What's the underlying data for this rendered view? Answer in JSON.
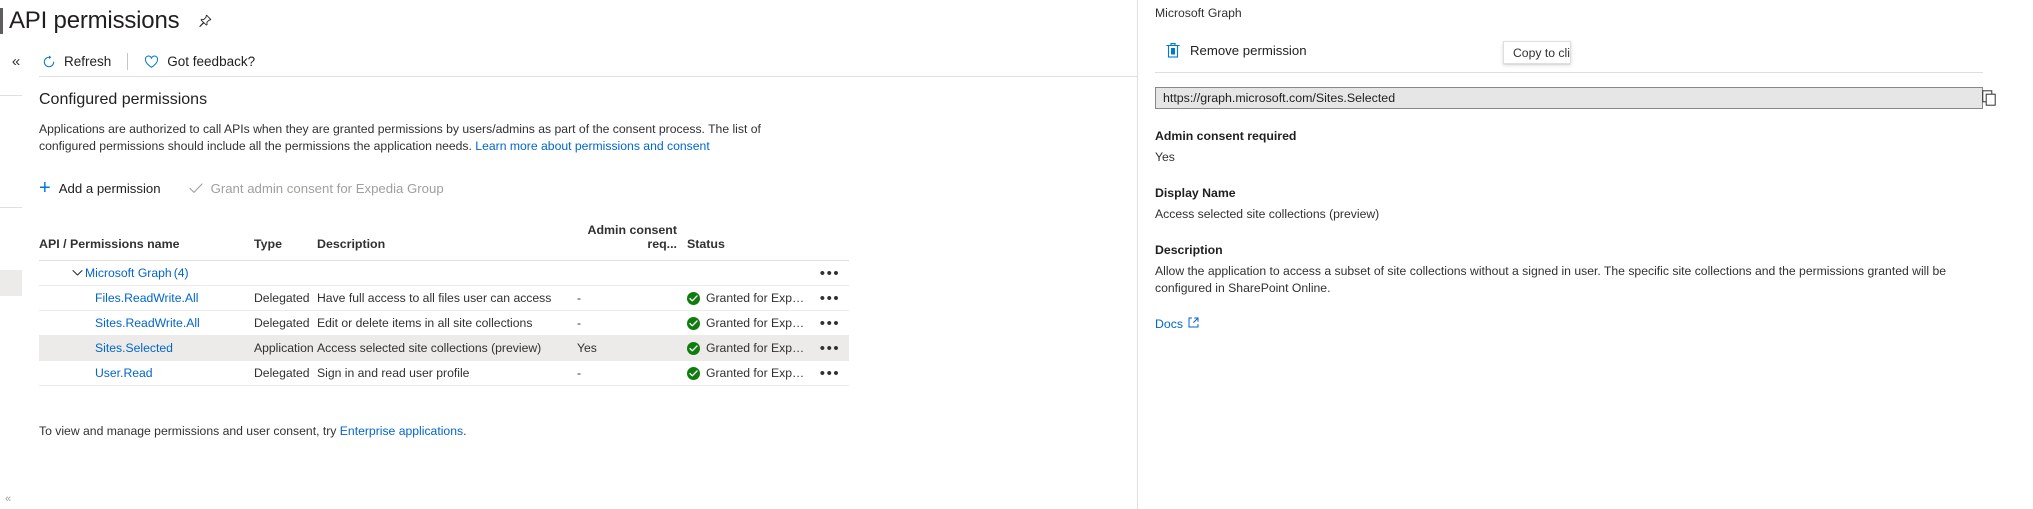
{
  "header": {
    "title": "API permissions",
    "pin_icon": "pin-icon"
  },
  "commandbar": {
    "collapse_icon": "double-chevron-left-icon",
    "refresh_label": "Refresh",
    "refresh_icon": "refresh-icon",
    "feedback_label": "Got feedback?",
    "feedback_icon": "heart-icon"
  },
  "main": {
    "section_title": "Configured permissions",
    "description_part1": "Applications are authorized to call APIs when they are granted permissions by users/admins as part of the consent process. The list of configured permissions should include all the permissions the application needs. ",
    "description_link": "Learn more about permissions and consent",
    "add_permission_label": "Add a permission",
    "add_permission_icon": "plus-icon",
    "grant_consent_label": "Grant admin consent for Expedia Group",
    "grant_consent_icon": "checkmark-icon",
    "footer_note_part1": "To view and manage permissions and user consent, try ",
    "footer_note_link": "Enterprise applications",
    "footer_note_part2": "."
  },
  "table": {
    "columns": [
      "API / Permissions name",
      "Type",
      "Description",
      "Admin consent req...",
      "Status"
    ],
    "group": {
      "chevron_icon": "chevron-down-icon",
      "name": "Microsoft Graph",
      "count": "(4)",
      "ellipsis": "•••"
    },
    "rows": [
      {
        "name": "Files.ReadWrite.All",
        "type": "Delegated",
        "description": "Have full access to all files user can access",
        "admin_consent": "-",
        "status": "Granted for Expedia Gro...",
        "status_icon": "green-check-icon",
        "ellipsis": "•••",
        "selected": false
      },
      {
        "name": "Sites.ReadWrite.All",
        "type": "Delegated",
        "description": "Edit or delete items in all site collections",
        "admin_consent": "-",
        "status": "Granted for Expedia Gro...",
        "status_icon": "green-check-icon",
        "ellipsis": "•••",
        "selected": false
      },
      {
        "name": "Sites.Selected",
        "type": "Application",
        "description": "Access selected site collections (preview)",
        "admin_consent": "Yes",
        "status": "Granted for Expedia Gro...",
        "status_icon": "green-check-icon",
        "ellipsis": "•••",
        "selected": true
      },
      {
        "name": "User.Read",
        "type": "Delegated",
        "description": "Sign in and read user profile",
        "admin_consent": "-",
        "status": "Granted for Expedia Gro...",
        "status_icon": "green-check-icon",
        "ellipsis": "•••",
        "selected": false
      }
    ]
  },
  "panel": {
    "subtitle": "Microsoft Graph",
    "remove_label": "Remove permission",
    "remove_icon": "trash-icon",
    "url_value": "https://graph.microsoft.com/Sites.Selected",
    "copy_icon": "copy-icon",
    "admin_consent_label": "Admin consent required",
    "admin_consent_value": "Yes",
    "display_name_label": "Display Name",
    "display_name_value": "Access selected site collections (preview)",
    "description_label": "Description",
    "description_value": "Allow the application to access a subset of site collections without a signed in user.  The specific site collections and the permissions granted will be configured in SharePoint Online.",
    "docs_label": "Docs",
    "docs_icon": "external-link-icon"
  },
  "tooltip": {
    "text": "Copy to clipboard"
  },
  "colors": {
    "accent": "#0078d4",
    "link": "#0066cc",
    "success": "#107c10",
    "selected_row": "#edebe9"
  }
}
